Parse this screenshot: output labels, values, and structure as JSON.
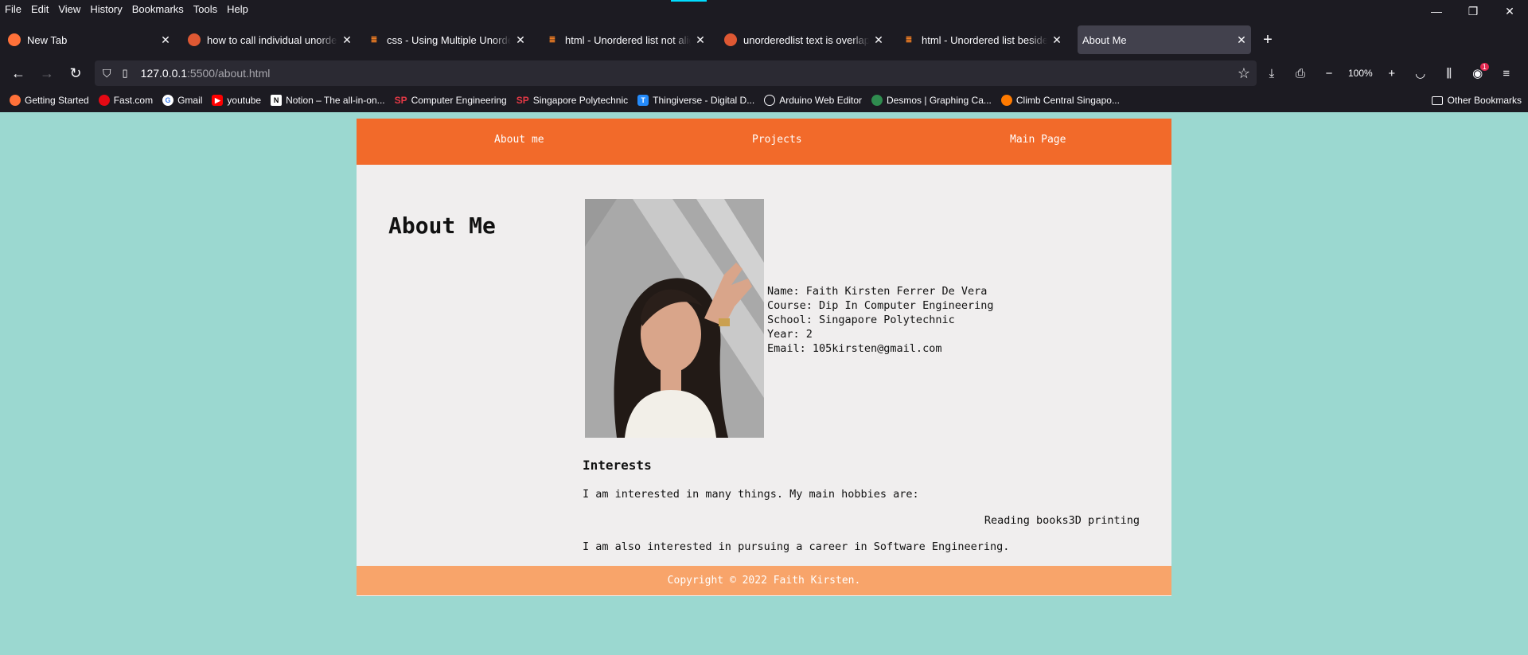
{
  "browser": {
    "menu": [
      "File",
      "Edit",
      "View",
      "History",
      "Bookmarks",
      "Tools",
      "Help"
    ],
    "window_controls": {
      "minimize": "—",
      "restore": "❐",
      "close": "✕"
    },
    "tabs": [
      {
        "label": "New Tab",
        "icon": "firefox-icon",
        "color": "#ff7139"
      },
      {
        "label": "how to call individual unordered list",
        "icon": "duckduckgo-icon",
        "color": "#de5833"
      },
      {
        "label": "css - Using Multiple Unordered Lists",
        "icon": "stackoverflow-icon",
        "color": "#f48024"
      },
      {
        "label": "html - Unordered list not aligning",
        "icon": "stackoverflow-icon",
        "color": "#f48024"
      },
      {
        "label": "unorderedlist text is overlapping",
        "icon": "duckduckgo-icon",
        "color": "#de5833"
      },
      {
        "label": "html - Unordered list beside paragraph",
        "icon": "stackoverflow-icon",
        "color": "#f48024"
      },
      {
        "label": "About Me",
        "icon": "",
        "color": ""
      }
    ],
    "url_host": "127.0.0.1",
    "url_path": ":5500/about.html",
    "zoom": "100%",
    "extension_badge": "1",
    "bookmarks": [
      {
        "label": "Getting Started",
        "icon": "firefox-icon",
        "color": "#ff7139"
      },
      {
        "label": "Fast.com",
        "icon": "speedometer-icon",
        "color": "#e50914"
      },
      {
        "label": "Gmail",
        "icon": "google-icon",
        "color": "#4285f4"
      },
      {
        "label": "youtube",
        "icon": "youtube-icon",
        "color": "#ff0000"
      },
      {
        "label": "Notion – The all-in-on...",
        "icon": "notion-icon",
        "color": "#ffffff"
      },
      {
        "label": "Computer Engineering",
        "icon": "sp-logo-icon",
        "color": "#e63946"
      },
      {
        "label": "Singapore Polytechnic",
        "icon": "sp-logo-icon",
        "color": "#e63946"
      },
      {
        "label": "Thingiverse - Digital D...",
        "icon": "thingiverse-icon",
        "color": "#248bfb"
      },
      {
        "label": "Arduino Web Editor",
        "icon": "globe-icon",
        "color": "#fbfbfe"
      },
      {
        "label": "Desmos | Graphing Ca...",
        "icon": "desmos-icon",
        "color": "#2f8c4f"
      },
      {
        "label": "Climb Central Singapo...",
        "icon": "climb-icon",
        "color": "#ff7a00"
      }
    ],
    "other_bookmarks": "Other Bookmarks"
  },
  "site": {
    "nav": [
      "About me",
      "Projects",
      "Main Page"
    ],
    "title": "About Me",
    "details": [
      "Name: Faith Kirsten Ferrer De Vera",
      "Course: Dip In Computer Engineering",
      "School: Singapore Polytechnic",
      "Year: 2",
      "Email: 105kirsten@gmail.com"
    ],
    "interests_title": "Interests",
    "interests_text": "I am interested in many things. My main hobbies are:",
    "hobbies": [
      "Reading books",
      "3D printing"
    ],
    "career_text": "I am also interested in pursuing a career in Software Engineering.",
    "footer": "Copyright © 2022 Faith Kirsten.",
    "colors": {
      "nav": "#f26a2a",
      "footer": "#f8a46a",
      "page_bg": "#9bd8d0",
      "content_bg": "#f0eeee"
    }
  }
}
